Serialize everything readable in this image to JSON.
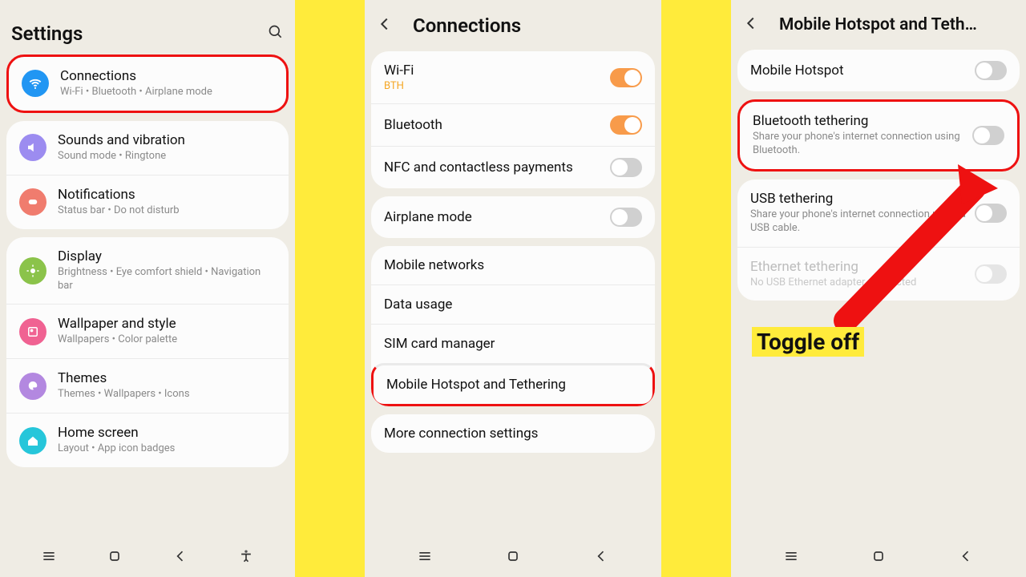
{
  "p1": {
    "title": "Settings",
    "rows": {
      "connections": {
        "title": "Connections",
        "sub": "Wi-Fi  •  Bluetooth  •  Airplane mode"
      },
      "sounds": {
        "title": "Sounds and vibration",
        "sub": "Sound mode  •  Ringtone"
      },
      "notif": {
        "title": "Notifications",
        "sub": "Status bar  •  Do not disturb"
      },
      "display": {
        "title": "Display",
        "sub": "Brightness  •  Eye comfort shield  •  Navigation bar"
      },
      "wall": {
        "title": "Wallpaper and style",
        "sub": "Wallpapers  •  Color palette"
      },
      "themes": {
        "title": "Themes",
        "sub": "Themes  •  Wallpapers  •  Icons"
      },
      "home": {
        "title": "Home screen",
        "sub": "Layout  •  App icon badges"
      }
    }
  },
  "p2": {
    "title": "Connections",
    "rows": {
      "wifi": {
        "title": "Wi-Fi",
        "sub": "BTH"
      },
      "bt": {
        "title": "Bluetooth"
      },
      "nfc": {
        "title": "NFC and contactless payments"
      },
      "air": {
        "title": "Airplane mode"
      },
      "mnet": {
        "title": "Mobile networks"
      },
      "data": {
        "title": "Data usage"
      },
      "sim": {
        "title": "SIM card manager"
      },
      "hot": {
        "title": "Mobile Hotspot and Tethering"
      },
      "more": {
        "title": "More connection settings"
      }
    }
  },
  "p3": {
    "title": "Mobile Hotspot and Teth…",
    "rows": {
      "mh": {
        "title": "Mobile Hotspot"
      },
      "btt": {
        "title": "Bluetooth tethering",
        "sub": "Share your phone's internet connection using Bluetooth."
      },
      "usb": {
        "title": "USB tethering",
        "sub": "Share your phone's internet connection using a USB cable."
      },
      "eth": {
        "title": "Ethernet tethering",
        "sub": "No USB Ethernet adapter connected"
      }
    }
  },
  "callout": "Toggle off"
}
